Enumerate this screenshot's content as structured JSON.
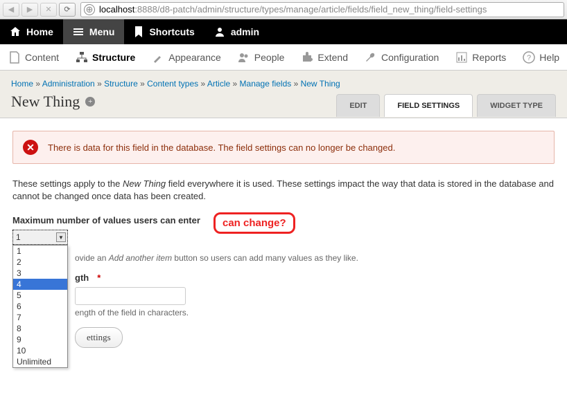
{
  "browser": {
    "host": "localhost",
    "port": ":8888",
    "path": "/d8-patch/admin/structure/types/manage/article/fields/field_new_thing/field-settings"
  },
  "topbar": {
    "home": "Home",
    "menu": "Menu",
    "shortcuts": "Shortcuts",
    "admin": "admin"
  },
  "secbar": {
    "content": "Content",
    "structure": "Structure",
    "appearance": "Appearance",
    "people": "People",
    "extend": "Extend",
    "configuration": "Configuration",
    "reports": "Reports",
    "help": "Help"
  },
  "breadcrumb": {
    "items": [
      "Home",
      "Administration",
      "Structure",
      "Content types",
      "Article",
      "Manage fields",
      "New Thing"
    ],
    "sep": " » "
  },
  "page_title": "New Thing",
  "tabs": {
    "edit": "EDIT",
    "field_settings": "FIELD SETTINGS",
    "widget_type": "WIDGET TYPE"
  },
  "message": "There is data for this field in the database. The field settings can no longer be changed.",
  "description_pre": "These settings apply to the ",
  "description_em": "New Thing",
  "description_post": " field everywhere it is used. These settings impact the way that data is stored in the database and cannot be changed once data has been created.",
  "cardinality": {
    "label": "Maximum number of values users can enter",
    "value": "1",
    "options": [
      "1",
      "2",
      "3",
      "4",
      "5",
      "6",
      "7",
      "8",
      "9",
      "10",
      "Unlimited"
    ],
    "highlighted": "4",
    "help_fragment": "ovide an ",
    "help_em": "Add another item",
    "help_rest": " button so users can add many values as they like."
  },
  "maxlength": {
    "label_fragment": "gth",
    "help": "ength of the field in characters."
  },
  "save": "ettings",
  "annotation": "can change?"
}
